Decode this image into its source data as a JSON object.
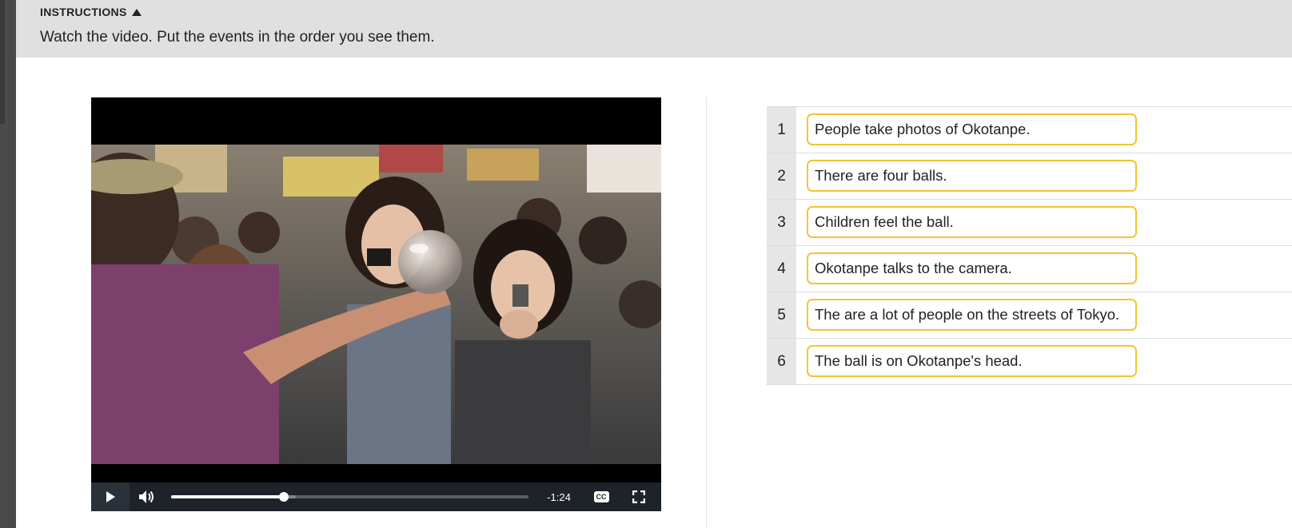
{
  "instructions": {
    "header": "INSTRUCTIONS",
    "text": "Watch the video. Put the events in the order you see them."
  },
  "video": {
    "time_remaining": "-1:24",
    "progress": 0.315,
    "buffered": 0.35,
    "cc_label": "CC",
    "icons": [
      "play-icon",
      "volume-icon",
      "closed-captions-icon",
      "fullscreen-icon"
    ]
  },
  "items": [
    {
      "number": "1",
      "text": "People take photos of Okotanpe."
    },
    {
      "number": "2",
      "text": "There are four balls."
    },
    {
      "number": "3",
      "text": "Children feel the ball."
    },
    {
      "number": "4",
      "text": "Okotanpe talks to the camera."
    },
    {
      "number": "5",
      "text": "The are a lot of people on the streets of Tokyo."
    },
    {
      "number": "6",
      "text": "The ball is on Okotanpe's head."
    }
  ],
  "colors": {
    "item_border": "#f6c232",
    "instructions_bg": "#e0e0e0",
    "controls_bg": "#1d2329"
  }
}
